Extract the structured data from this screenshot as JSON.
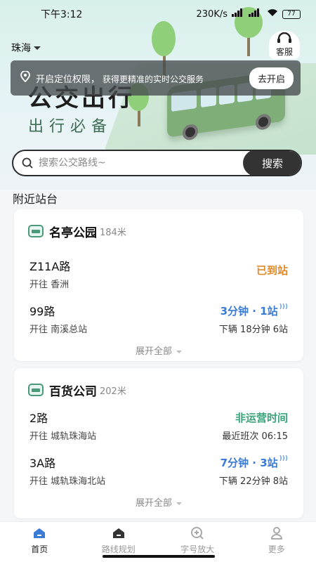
{
  "status_bar": {
    "time": "下午3:12",
    "network_speed": "230K/s",
    "battery": "77"
  },
  "header": {
    "city": "珠海",
    "service_label": "客服",
    "title": "公交出行",
    "subtitle": "出行必备"
  },
  "location_banner": {
    "title": "开启定位权限，",
    "desc": "获得更精准的实时公交服务",
    "button": "去开启"
  },
  "search": {
    "placeholder": "搜索公交路线~",
    "button": "搜索"
  },
  "nearby": {
    "label": "附近站台",
    "stations": [
      {
        "name": "名亭公园",
        "distance": "184米",
        "routes": [
          {
            "name": "Z11A路",
            "direction": "开往 香洲",
            "status": "已到站",
            "sub": ""
          },
          {
            "name": "99路",
            "direction": "开往 南溪总站",
            "status": "3分钟 · 1站",
            "sub": "下辆 18分钟 6站"
          }
        ],
        "expand": "展开全部"
      },
      {
        "name": "百货公司",
        "distance": "202米",
        "routes": [
          {
            "name": "2路",
            "direction": "开往 城轨珠海站",
            "status": "非运营时间",
            "sub": "最近班次 06:15"
          },
          {
            "name": "3A路",
            "direction": "开往 城轨珠海北站",
            "status": "7分钟 · 3站",
            "sub": "下辆 22分钟 8站"
          }
        ],
        "expand": "展开全部"
      }
    ]
  },
  "tabbar": [
    {
      "label": "首页",
      "icon": "home-icon",
      "active": true
    },
    {
      "label": "路线规划",
      "icon": "route-icon",
      "active": false
    },
    {
      "label": "字号放大",
      "icon": "zoom-icon",
      "active": false
    },
    {
      "label": "更多",
      "icon": "user-icon",
      "active": false
    }
  ],
  "colors": {
    "arrived": "#e08a2c",
    "realtime": "#3a7bd5",
    "not_operating": "#3aa37a",
    "search_button": "#333333"
  }
}
